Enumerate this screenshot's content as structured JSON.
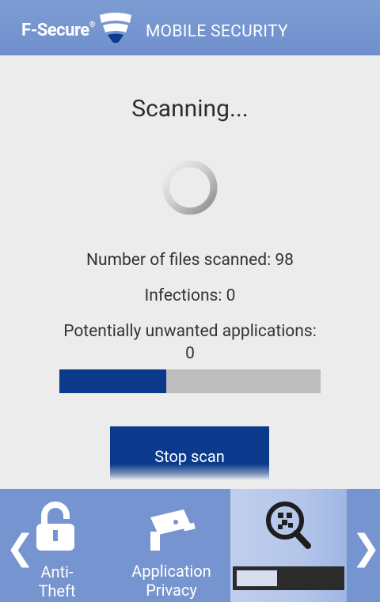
{
  "header": {
    "brand": "F-Secure",
    "brand_mark": "®",
    "app_title": "MOBILE SECURITY"
  },
  "scan": {
    "title": "Scanning...",
    "files_scanned": "Number of files scanned: 98",
    "infections": "Infections: 0",
    "pua_label": "Potentially unwanted applications:",
    "pua_value": "0",
    "progress_percent": 41,
    "stop_label": "Stop scan"
  },
  "bottom_nav": {
    "items": [
      {
        "label_line1": "Anti-",
        "label_line2": "Theft",
        "icon": "padlock-icon"
      },
      {
        "label_line1": "Application",
        "label_line2": "Privacy",
        "icon": "camera-icon"
      },
      {
        "label_line1": "",
        "label_line2": "",
        "icon": "virus-scan-icon"
      }
    ],
    "active_progress_percent": 39
  },
  "colors": {
    "header": "#7694cf",
    "accent": "#0b3a8c",
    "background": "#ececec"
  }
}
